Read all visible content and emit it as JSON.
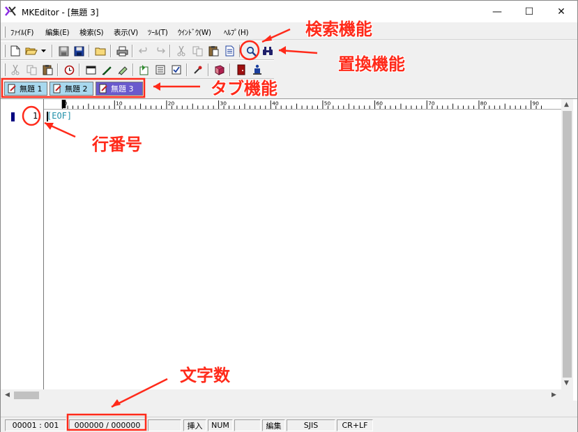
{
  "window": {
    "title": "MKEditor - [無題 3]",
    "minimize": "—",
    "maximize": "☐",
    "close": "✕"
  },
  "menu": [
    "ﾌｧｲﾙ(F)",
    "編集(E)",
    "検索(S)",
    "表示(V)",
    "ﾂｰﾙ(T)",
    "ｳｲﾝﾄﾞｳ(W)",
    "ﾍﾙﾌﾟ(H)"
  ],
  "tabs": [
    "無題 1",
    "無題 2",
    "無題 3"
  ],
  "editor": {
    "line_number": "1",
    "eof": "[EOF]",
    "ruler_labels": [
      "0",
      "10",
      "20",
      "30",
      "40",
      "50",
      "60",
      "70",
      "80",
      "90"
    ]
  },
  "statusbar": {
    "position": "00001 : 001",
    "char_count": "000000 / 000000",
    "insert_mode": "挿入",
    "numlock": "NUM",
    "edit_state": "編集",
    "encoding": "SJIS",
    "line_ending": "CR+LF"
  },
  "annotations": {
    "search": "検索機能",
    "replace": "置換機能",
    "tab": "タブ機能",
    "line_number": "行番号",
    "char_count": "文字数"
  },
  "colors": {
    "annotation": "#ff2a1a",
    "active_tab": "#6a5acd",
    "inactive_tab": "#a8d8ee",
    "eof": "#1f8fa8"
  }
}
